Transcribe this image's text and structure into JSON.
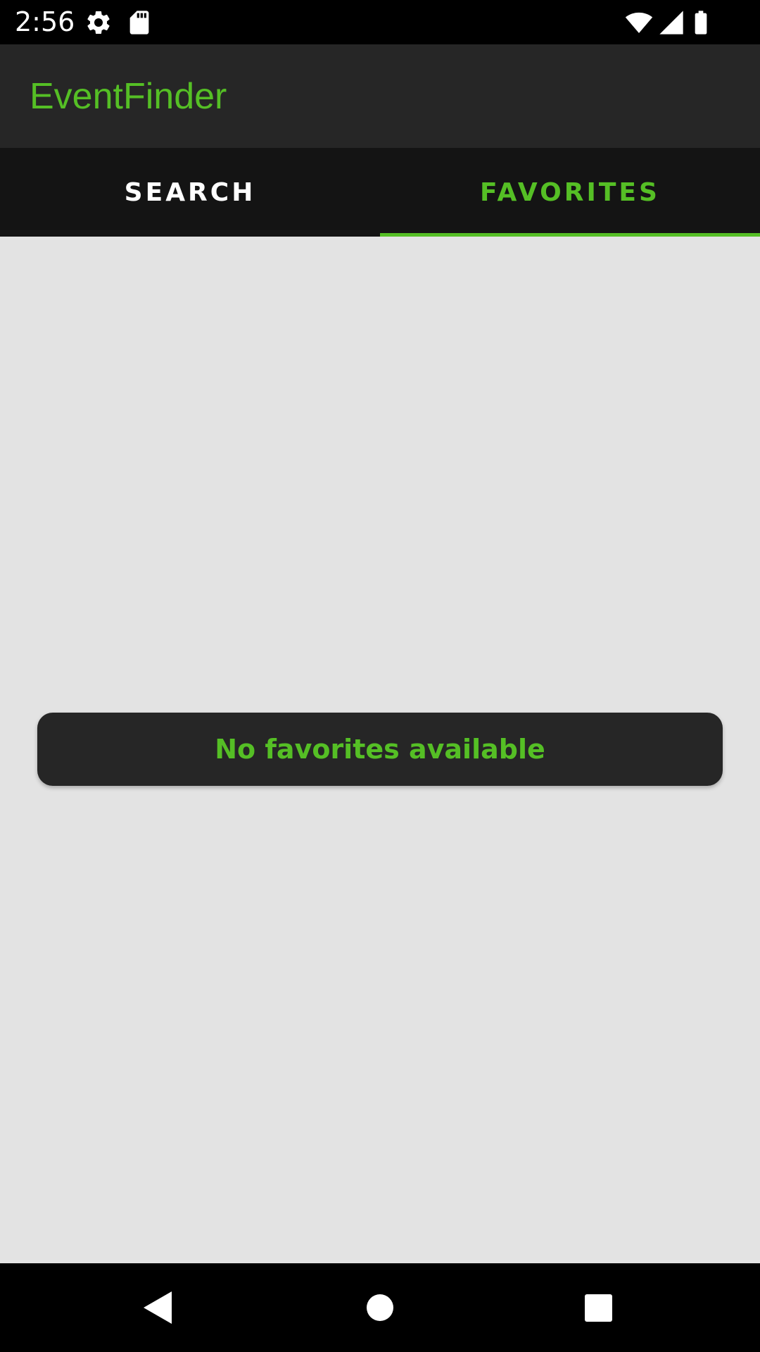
{
  "status_bar": {
    "time": "2:56",
    "icons_left": [
      "gear-icon",
      "sd-card-icon"
    ],
    "icons_right": [
      "wifi-icon",
      "signal-icon",
      "battery-icon"
    ]
  },
  "app_bar": {
    "title": "EventFinder"
  },
  "tabs": [
    {
      "label": "SEARCH",
      "selected": false
    },
    {
      "label": "FAVORITES",
      "selected": true
    }
  ],
  "main": {
    "empty_message": "No favorites available"
  },
  "nav_bar": {
    "buttons": [
      "back-icon",
      "home-icon",
      "recents-icon"
    ]
  },
  "colors": {
    "accent": "#55bf25",
    "app_bar_bg": "#262626",
    "tab_bar_bg": "#141414",
    "content_bg": "#e3e3e3",
    "inactive_tab_text": "#ffffff"
  }
}
